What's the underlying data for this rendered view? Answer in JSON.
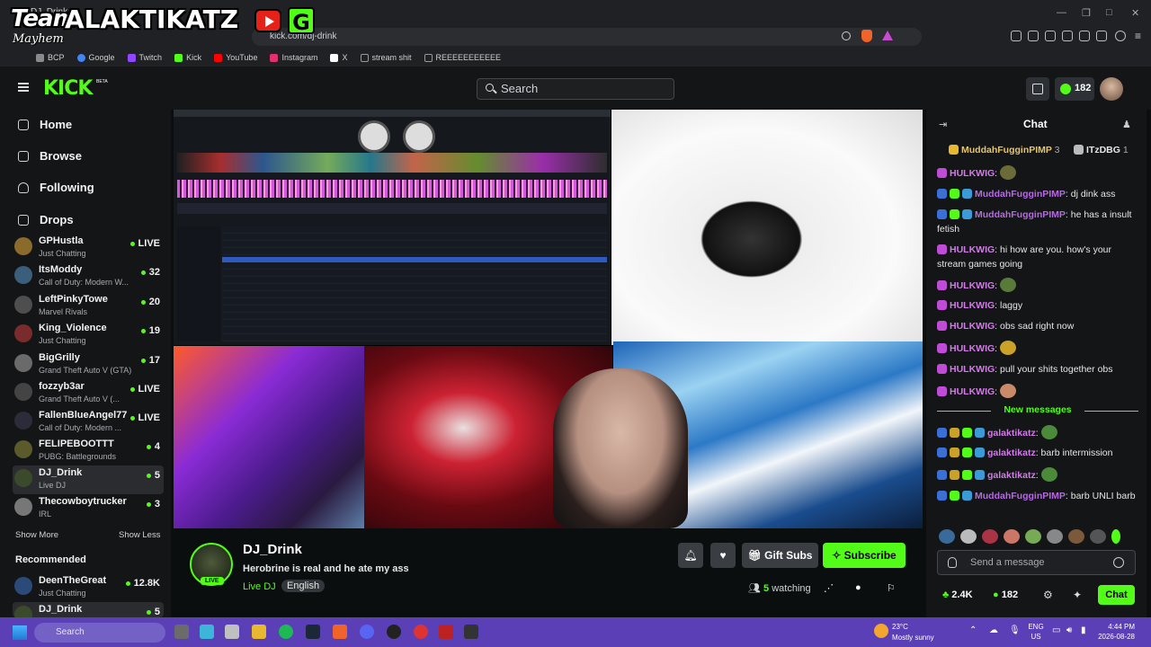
{
  "browser": {
    "tab_title": "DJ_Drink",
    "address": "kick.com/dj-drink",
    "bookmarks": [
      {
        "label": "BCP",
        "color": "#8a8a8a"
      },
      {
        "label": "Google",
        "color": "#4285f4"
      },
      {
        "label": "Twitch",
        "color": "#9146ff"
      },
      {
        "label": "Kick",
        "color": "#53fc18"
      },
      {
        "label": "YouTube",
        "color": "#ff0000"
      },
      {
        "label": "Instagram",
        "color": "#e1306c"
      },
      {
        "label": "X",
        "color": "#ffffff"
      },
      {
        "label": "stream shit",
        "color": "#999999"
      },
      {
        "label": "REEEEEEEEEEE",
        "color": "#999999"
      }
    ]
  },
  "overlay": {
    "team": "Team",
    "name": "ALAKTIKATZ",
    "mayhem": "Mayhem",
    "g": "G"
  },
  "header": {
    "logo": "KICK",
    "beta": "BETA",
    "search_placeholder": "Search",
    "kicks_count": "182"
  },
  "sidebar": {
    "nav": [
      {
        "label": "Home",
        "icon": "home-icon"
      },
      {
        "label": "Browse",
        "icon": "browse-icon"
      },
      {
        "label": "Following",
        "icon": "heart-icon"
      },
      {
        "label": "Drops",
        "icon": "gift-icon"
      }
    ],
    "following": [
      {
        "name": "GPHustla",
        "category": "Just Chatting",
        "viewers": "LIVE",
        "color": "#8a6b2b"
      },
      {
        "name": "ItsModdy",
        "category": "Call of Duty: Modern W...",
        "viewers": "32",
        "color": "#3b5e7a"
      },
      {
        "name": "LeftPinkyTowe",
        "category": "Marvel Rivals",
        "viewers": "20",
        "color": "#4e4e4e"
      },
      {
        "name": "King_Violence",
        "category": "Just Chatting",
        "viewers": "19",
        "color": "#7a2b2b"
      },
      {
        "name": "BigGrilly",
        "category": "Grand Theft Auto V (GTA)",
        "viewers": "17",
        "color": "#6a6a6a"
      },
      {
        "name": "fozzyb3ar",
        "category": "Grand Theft Auto V (...",
        "viewers": "LIVE",
        "color": "#444444"
      },
      {
        "name": "FallenBlueAngel77",
        "category": "Call of Duty: Modern ...",
        "viewers": "LIVE",
        "color": "#2b2b3a"
      },
      {
        "name": "FELIPEBOOTTT",
        "category": "PUBG: Battlegrounds",
        "viewers": "4",
        "color": "#5a5a2b"
      },
      {
        "name": "DJ_Drink",
        "category": "Live DJ",
        "viewers": "5",
        "color": "#3a4a2b"
      },
      {
        "name": "Thecowboytrucker",
        "category": "IRL",
        "viewers": "3",
        "color": "#777777"
      }
    ],
    "show_more": "Show More",
    "show_less": "Show Less",
    "recommended_title": "Recommended",
    "recommended": [
      {
        "name": "DeenTheGreat",
        "category": "Just Chatting",
        "viewers": "12.8K",
        "color": "#2b4a7a"
      },
      {
        "name": "DJ_Drink",
        "category": "",
        "viewers": "5",
        "color": "#3a4a2b"
      }
    ]
  },
  "channel": {
    "name": "DJ_Drink",
    "live": "LIVE",
    "title": "Herobrine is real and he ate my ass",
    "category": "Live DJ",
    "language": "English",
    "gift_subs": "Gift Subs",
    "subscribe": "Subscribe",
    "watching_count": "5",
    "watching_label": "watching"
  },
  "chat": {
    "title": "Chat",
    "leaderboard": [
      {
        "name": "MuddahFugginPIMP",
        "count": "3"
      },
      {
        "name": "ITzDBG",
        "count": "1"
      }
    ],
    "messages": [
      {
        "user": "HULKWIG",
        "text": "",
        "color": "#d27be8",
        "emote": "#6b6b3a"
      },
      {
        "user": "MuddahFugginPIMP",
        "text": ": dj dink ass",
        "color": "#b56be0",
        "emote": ""
      },
      {
        "user": "MuddahFugginPIMP",
        "text": ": he has a insult fetish",
        "color": "#b56be0",
        "emote": ""
      },
      {
        "user": "HULKWIG",
        "text": ": hi how are you. how's your stream games going",
        "color": "#d27be8",
        "emote": ""
      },
      {
        "user": "HULKWIG",
        "text": ": ",
        "color": "#d27be8",
        "emote": "#5a7a3a"
      },
      {
        "user": "HULKWIG",
        "text": ": laggy",
        "color": "#d27be8",
        "emote": ""
      },
      {
        "user": "HULKWIG",
        "text": ": obs sad right now",
        "color": "#d27be8",
        "emote": ""
      },
      {
        "user": "HULKWIG",
        "text": ": ",
        "color": "#d27be8",
        "emote": "#c9a227"
      },
      {
        "user": "HULKWIG",
        "text": ": pull your shits together obs",
        "color": "#d27be8",
        "emote": ""
      },
      {
        "user": "HULKWIG",
        "text": ": ",
        "color": "#d27be8",
        "emote": "#c98a6a"
      }
    ],
    "new_messages": "New messages",
    "new": [
      {
        "user": "galaktikatz",
        "text": ": ",
        "color": "#d27be8",
        "emote": "#4a8a3a"
      },
      {
        "user": "galaktikatz",
        "text": ": barb intermission",
        "color": "#d27be8",
        "emote": ""
      },
      {
        "user": "galaktikatz",
        "text": ": ",
        "color": "#d27be8",
        "emote": "#4a8a3a"
      },
      {
        "user": "MuddahFugginPIMP",
        "text": ": barb UNLI barb",
        "color": "#b56be0",
        "emote": ""
      }
    ],
    "send_placeholder": "Send a message",
    "followers": "2.4K",
    "kicks": "182",
    "chat_button": "Chat"
  },
  "taskbar": {
    "search": "Search",
    "weather_temp": "23°C",
    "weather_desc": "Mostly sunny",
    "lang1": "ENG",
    "lang2": "US",
    "time": "4:44 PM",
    "date": "2026-08-28"
  }
}
